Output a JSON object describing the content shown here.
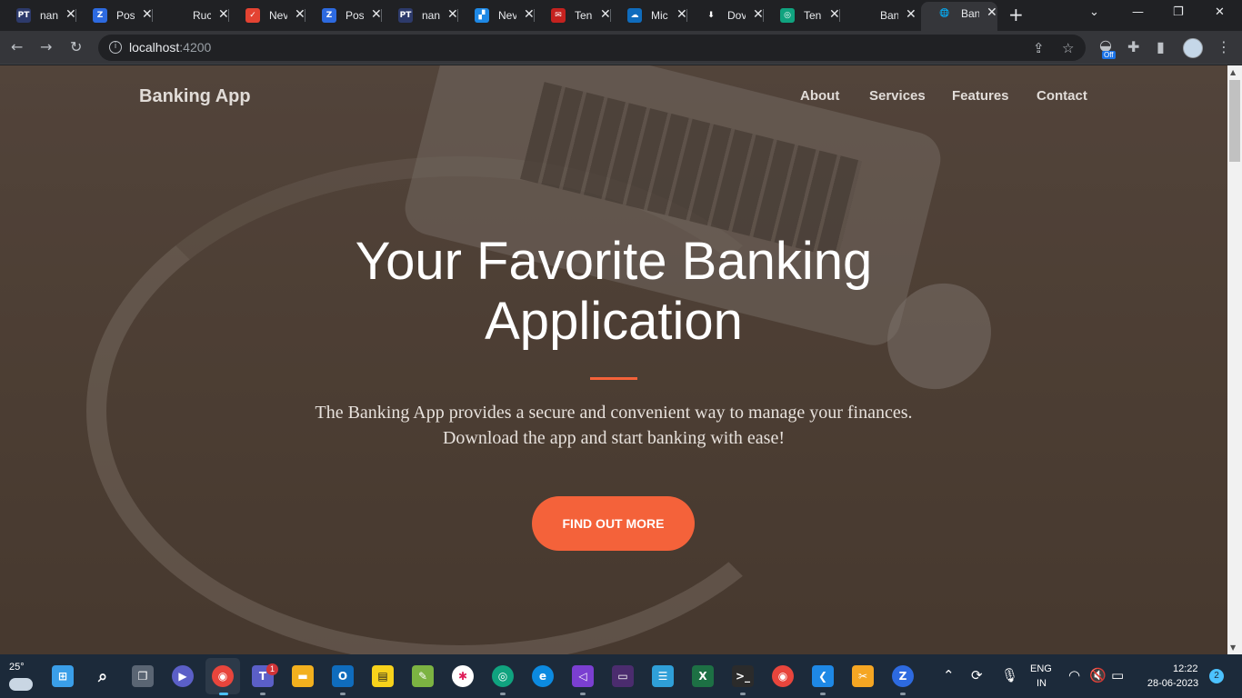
{
  "browser": {
    "tabs": [
      {
        "title": "nan",
        "favicon": "PT",
        "color": "#2d3a6b"
      },
      {
        "title": "Pos",
        "favicon": "Z",
        "color": "#2d6ae0"
      },
      {
        "title": "Ruc",
        "favicon": "",
        "color": "#202124"
      },
      {
        "title": "Nev",
        "favicon": "✓",
        "color": "#e44332"
      },
      {
        "title": "Pos",
        "favicon": "Z",
        "color": "#2d6ae0"
      },
      {
        "title": "nan",
        "favicon": "PT",
        "color": "#2d3a6b"
      },
      {
        "title": "Nev",
        "favicon": "▞",
        "color": "#1e88e5"
      },
      {
        "title": "Ten",
        "favicon": "✉",
        "color": "#c5221f"
      },
      {
        "title": "Mic",
        "favicon": "☁",
        "color": "#0f6cbd"
      },
      {
        "title": "Dov",
        "favicon": "⬇",
        "color": "#202124"
      },
      {
        "title": "Ten",
        "favicon": "◎",
        "color": "#10a37f"
      },
      {
        "title": "Ban",
        "favicon": "",
        "color": "#202124"
      },
      {
        "title": "Ban",
        "favicon": "🌐",
        "color": "#35363a",
        "active": true
      }
    ],
    "close_glyph": "✕",
    "new_tab_glyph": "+",
    "url_host": "localhost",
    "url_port": ":4200",
    "extension_badge": "Off"
  },
  "page": {
    "brand": "Banking App",
    "nav": [
      "About",
      "Services",
      "Features",
      "Contact"
    ],
    "hero_title": "Your Favorite Banking Application",
    "hero_text": "The Banking App provides a secure and convenient way to manage your finances. Download the app and start banking with ease!",
    "cta_label": "FIND OUT MORE",
    "accent_color": "#f4623a"
  },
  "taskbar": {
    "temperature": "25°",
    "language": "ENG",
    "region": "IN",
    "time": "12:22",
    "date": "28-06-2023",
    "notification_count": "2",
    "teams_badge": "1"
  }
}
